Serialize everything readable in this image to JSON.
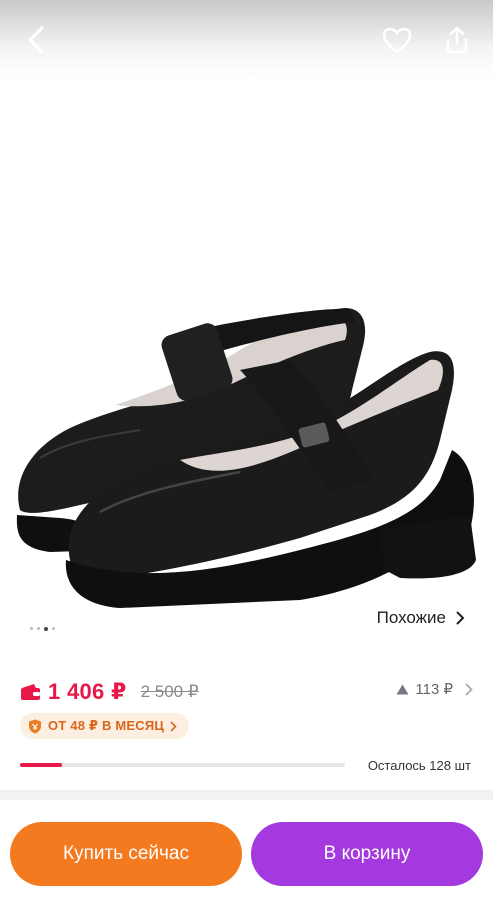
{
  "header": {
    "back_icon": "chevron-left-icon",
    "favorite_icon": "heart-icon",
    "share_icon": "share-icon"
  },
  "gallery": {
    "image_count": 4,
    "active_index": 2,
    "similar_label": "Похожие"
  },
  "price": {
    "current": "1 406 ₽",
    "old": "2 500 ₽",
    "accent_color": "#e8194a"
  },
  "rating": {
    "value": "113 ₽"
  },
  "installment": {
    "label": "ОТ 48 ₽ В МЕСЯЦ"
  },
  "stock": {
    "label": "Осталось 128 шт",
    "progress": 0.13
  },
  "actions": {
    "buy_now": "Купить сейчас",
    "add_to_cart": "В корзину",
    "buy_color": "#f47a1f",
    "cart_color": "#a439e0"
  }
}
